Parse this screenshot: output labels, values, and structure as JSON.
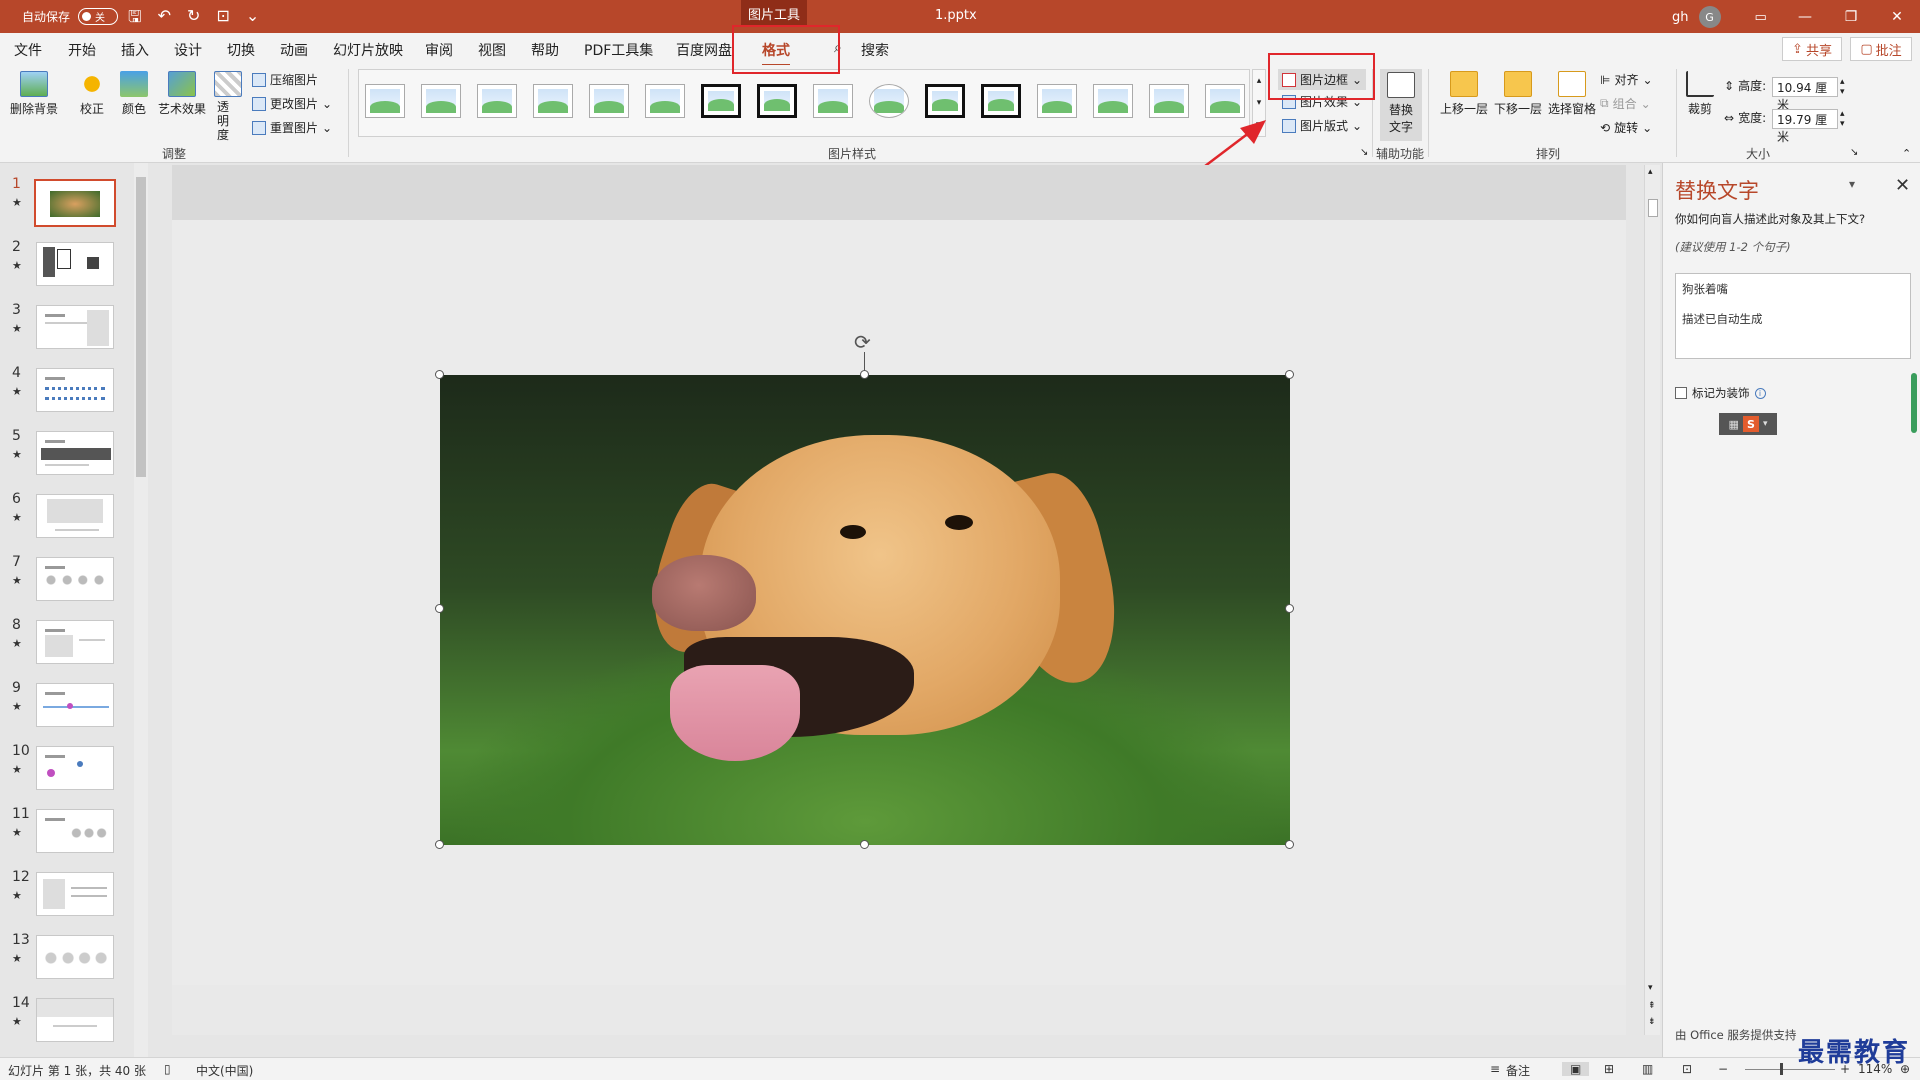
{
  "titlebar": {
    "autosave_label": "自动保存",
    "autosave_state": "关",
    "contextual_tab": "图片工具",
    "filename": "1.pptx",
    "user": "gh",
    "user_avatar": "G",
    "icons": [
      "save-icon",
      "undo-icon",
      "redo-icon",
      "present-icon",
      "customize-icon"
    ]
  },
  "tabs": [
    {
      "label": "文件",
      "active": false
    },
    {
      "label": "开始",
      "active": false
    },
    {
      "label": "插入",
      "active": false
    },
    {
      "label": "设计",
      "active": false
    },
    {
      "label": "切换",
      "active": false
    },
    {
      "label": "动画",
      "active": false
    },
    {
      "label": "幻灯片放映",
      "active": false
    },
    {
      "label": "审阅",
      "active": false
    },
    {
      "label": "视图",
      "active": false
    },
    {
      "label": "帮助",
      "active": false
    },
    {
      "label": "PDF工具集",
      "active": false
    },
    {
      "label": "百度网盘",
      "active": false
    },
    {
      "label": "格式",
      "active": true
    }
  ],
  "search_label": "搜索",
  "share_label": "共享",
  "comment_label": "批注",
  "ribbon": {
    "adjust": {
      "remove_bg": "删除背景",
      "correct": "校正",
      "color": "颜色",
      "art_effects": "艺术效果",
      "transparency": "透明度",
      "compress": "压缩图片",
      "change": "更改图片",
      "reset": "重置图片",
      "group_label": "调整"
    },
    "styles": {
      "group_label": "图片样式",
      "border": "图片边框",
      "effects": "图片效果",
      "layout": "图片版式"
    },
    "accessibility": {
      "alt_text_line1": "替换",
      "alt_text_line2": "文字",
      "group_label": "辅助功能"
    },
    "arrange": {
      "bring_forward": "上移一层",
      "send_backward": "下移一层",
      "selection_pane": "选择窗格",
      "align": "对齐",
      "group": "组合",
      "rotate": "旋转",
      "group_label": "排列"
    },
    "size": {
      "crop": "裁剪",
      "height_label": "高度:",
      "height_value": "10.94 厘米",
      "width_label": "宽度:",
      "width_value": "19.79 厘米",
      "group_label": "大小"
    }
  },
  "slides": [
    "1",
    "2",
    "3",
    "4",
    "5",
    "6",
    "7",
    "8",
    "9",
    "10",
    "11",
    "12",
    "13",
    "14"
  ],
  "pane": {
    "title": "替换文字",
    "question": "你如何向盲人描述此对象及其上下文?",
    "hint": "(建议使用 1-2 个句子)",
    "text_line1": "狗张着嘴",
    "text_line2": "描述已自动生成",
    "decorative_label": "标记为装饰",
    "footer": "由 Office 服务提供支持"
  },
  "status": {
    "slide_info": "幻灯片 第 1 张，共 40 张",
    "language": "中文(中国)",
    "notes": "备注",
    "zoom": "114%"
  },
  "watermark": "最需教育",
  "colors": {
    "accent": "#b7472a",
    "highlight": "#e0262b"
  }
}
